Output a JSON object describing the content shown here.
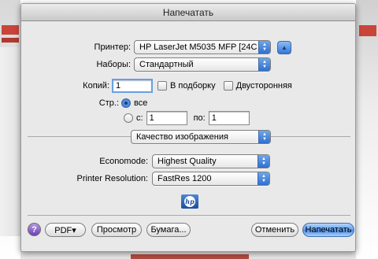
{
  "dialog": {
    "title": "Напечатать"
  },
  "printer": {
    "label": "Принтер:",
    "value": "HP LaserJet M5035 MFP [24C…"
  },
  "presets": {
    "label": "Наборы:",
    "value": "Стандартный"
  },
  "copies": {
    "label": "Копий:",
    "value": "1",
    "collated_label": "В подборку",
    "two_sided_label": "Двусторонняя"
  },
  "pages": {
    "label": "Стр.:",
    "all_label": "все",
    "from_label": "с:",
    "from_value": "1",
    "to_label": "по:",
    "to_value": "1"
  },
  "panel": {
    "value": "Качество изображения"
  },
  "economode": {
    "label": "Economode:",
    "value": "Highest Quality"
  },
  "resolution": {
    "label": "Printer Resolution:",
    "value": "FastRes 1200"
  },
  "buttons": {
    "help": "?",
    "pdf": "PDF▾",
    "preview": "Просмотр",
    "paper": "Бумага...",
    "cancel": "Отменить",
    "print": "Напечатать"
  },
  "logo": {
    "icon": "hp-logo",
    "text": "hp"
  }
}
